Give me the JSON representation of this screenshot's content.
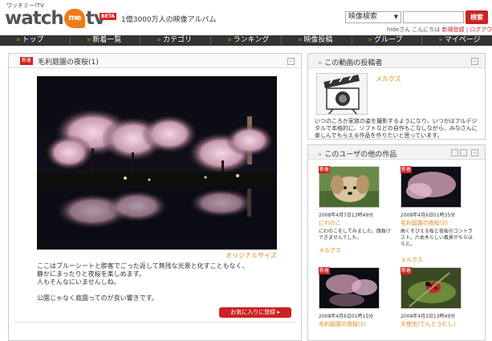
{
  "header": {
    "logo_sub": "ワッチミー!TV",
    "logo_w": "watch",
    "logo_me": "me",
    "logo_tv": "tv",
    "beta": "BETA",
    "tagline": "1億3000万人の映像アルバム",
    "search_select": "映像検索",
    "search_button": "検索",
    "greeting": "hideさん こんにちは",
    "new_register": "新規登録",
    "logout": "ログアウト"
  },
  "nav": {
    "items": [
      "トップ",
      "新着一覧",
      "カテゴリ",
      "ランキング",
      "映像投稿",
      "グループ",
      "マイページ"
    ]
  },
  "main": {
    "badge": "新着",
    "title": "毛利庭園の夜桜(1)",
    "original_size": "オリジナルサイズ",
    "desc_line1": "ここはブルーシートと酔客でごった返して無残な光景と化すこともなく、",
    "desc_line2": "静かにまったりと夜桜を楽しめます。",
    "desc_line3": "人もそんなにいませんしね。",
    "desc_line4": "公園じゃなく庭園ってのが良い響きです。",
    "fav_button": "お気に入りに登録 ▸"
  },
  "poster": {
    "header": "この動画の投稿者",
    "name": "メルクス",
    "desc": "いつのころか家族の姿を撮影するようになり、いつかはフルデジタルで本格的に、ソフトなどの自作もこなしながら、みなさんに楽しんでもらえる作品を作りたいと思っています。"
  },
  "other_works": {
    "header": "このユーザの他の作品",
    "items": [
      {
        "badge": "新着",
        "date": "2008年4月7日13時49分",
        "title": "にわのこ",
        "desc": "にわのこをしてみました。顔負けできませんでした。",
        "user": "メルクス"
      },
      {
        "badge": "新着",
        "date": "2008年4月6日01時35分",
        "title": "毛利庭園の夜桜(2)",
        "desc": "高くそびえる桜と夜桜のコントラスト。六本木らしい風景がちらほらと。",
        "user": "メルクス"
      },
      {
        "badge": "新着",
        "date": "2008年4月6日01時15分",
        "title": "毛利庭園の夜桜(1)",
        "desc": "",
        "user": ""
      },
      {
        "badge": "新着",
        "date": "2008年4月3日13時49分",
        "title": "天使虫(てんとうむし)",
        "desc": "",
        "user": ""
      }
    ]
  },
  "colors": {
    "accent": "#f07b14",
    "brand_red": "#cc2222",
    "nav_bg": "#333333"
  }
}
